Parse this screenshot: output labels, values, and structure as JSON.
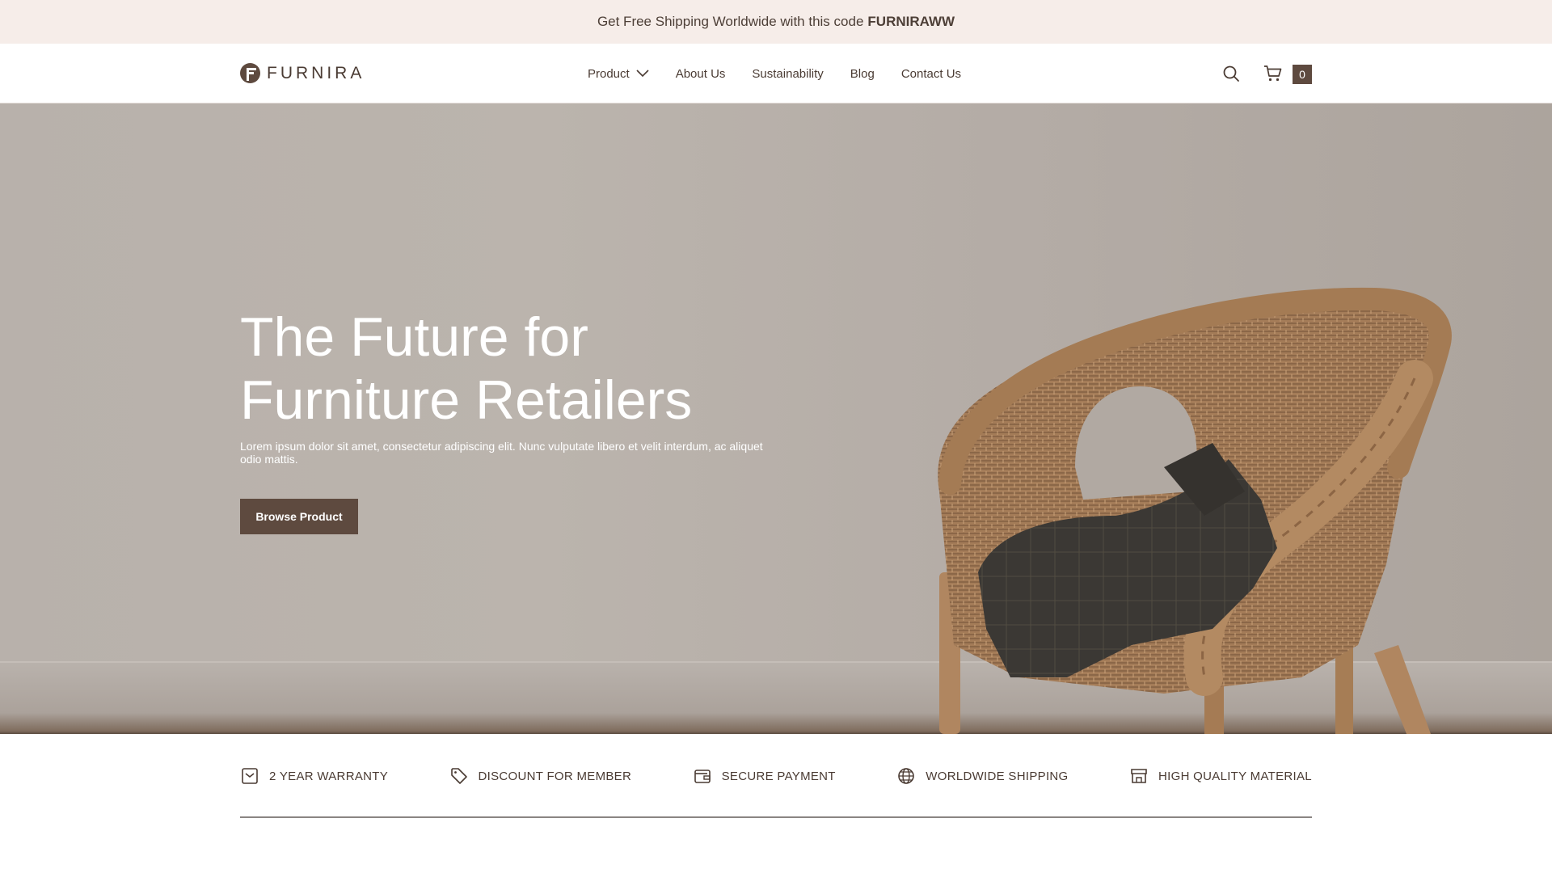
{
  "announcement": {
    "text": "Get Free Shipping Worldwide with this code",
    "code": "FURNIRAWW"
  },
  "header": {
    "logo_text": "FURNIRA",
    "nav": [
      {
        "label": "Product",
        "has_dropdown": true
      },
      {
        "label": "About Us"
      },
      {
        "label": "Sustainability"
      },
      {
        "label": "Blog"
      },
      {
        "label": "Contact Us"
      }
    ],
    "cart_count": "0"
  },
  "hero": {
    "title_line1": "The Future for",
    "title_line2": "Furniture Retailers",
    "subtitle": "Lorem ipsum dolor sit amet, consectetur adipiscing elit. Nunc vulputate libero et velit interdum, ac aliquet odio mattis.",
    "cta_label": "Browse Product"
  },
  "features": [
    {
      "icon": "warranty-icon",
      "label": "2 YEAR WARRANTY"
    },
    {
      "icon": "tag-icon",
      "label": "DISCOUNT FOR MEMBER"
    },
    {
      "icon": "wallet-icon",
      "label": "SECURE PAYMENT"
    },
    {
      "icon": "globe-icon",
      "label": "WORLDWIDE SHIPPING"
    },
    {
      "icon": "store-icon",
      "label": "HIGH QUALITY MATERIAL"
    }
  ],
  "colors": {
    "brand": "#5e4a3f",
    "announce_bg": "#f6ede9",
    "text": "#4a3b33"
  }
}
